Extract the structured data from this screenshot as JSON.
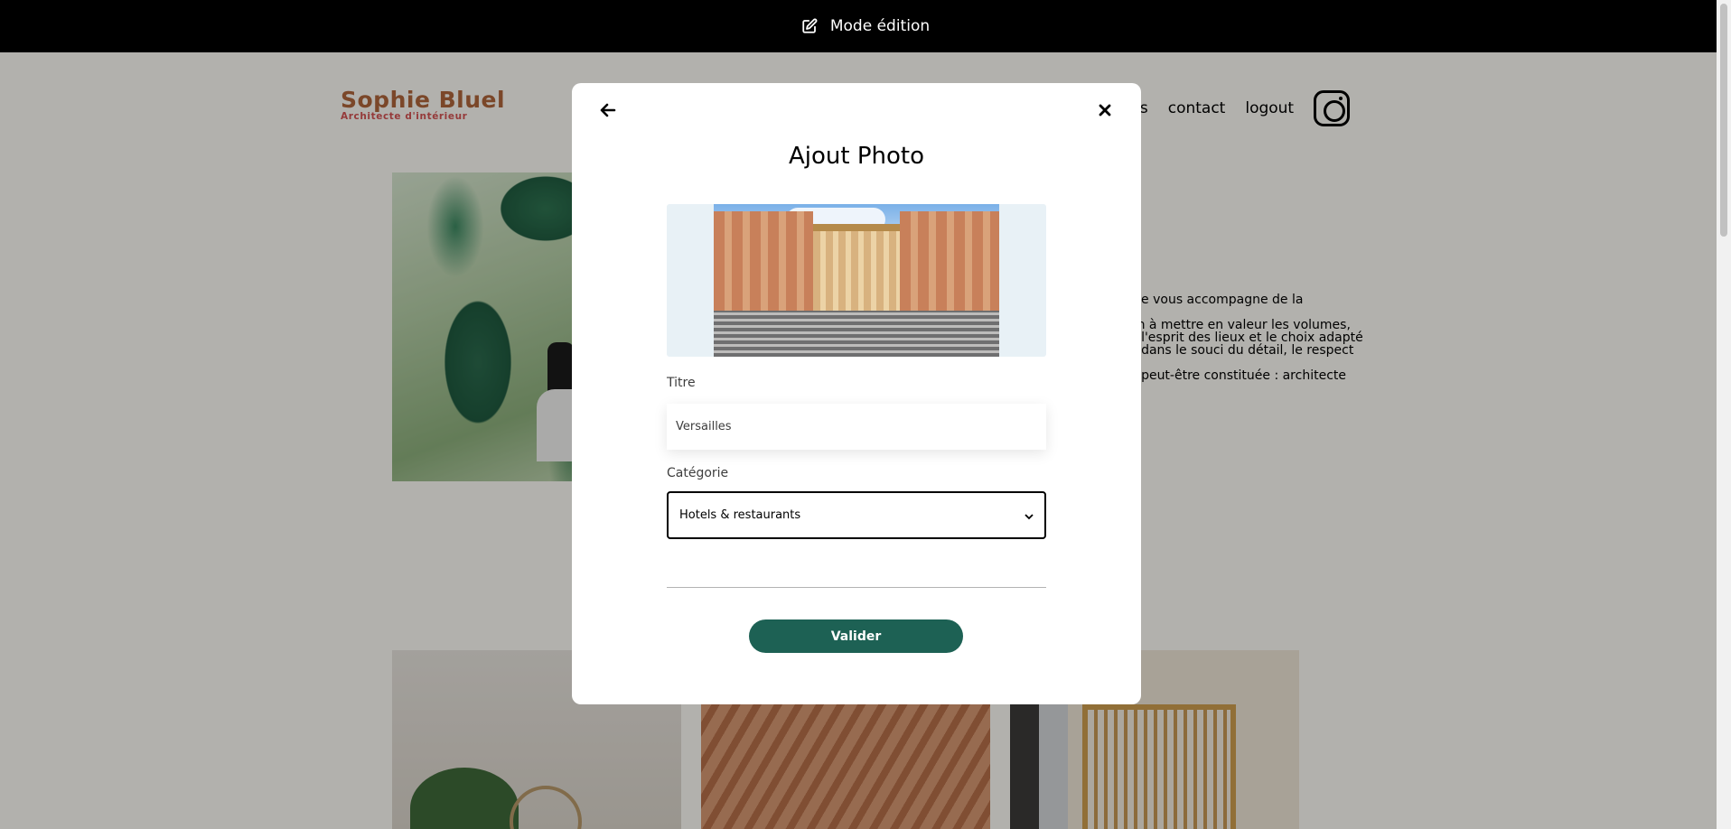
{
  "edit_bar": {
    "label": "Mode édition",
    "icon": "edit-icon"
  },
  "header": {
    "logo_title": "Sophie Bluel",
    "logo_subtitle": "Architecte d'intérieur",
    "nav": {
      "projects_partial": "jets",
      "contact": "contact",
      "logout": "logout",
      "instagram_icon": "instagram-icon"
    }
  },
  "intro": {
    "lines": [
      ". Je vous accompagne de la",
      "on à mettre en valeur les volumes,\ne l'esprit des lieux et le choix adapté\né dans le souci du détail, le respect",
      "e peut-être constituée : architecte"
    ]
  },
  "modal": {
    "title": "Ajout Photo",
    "back_icon": "arrow-left-icon",
    "close_icon": "close-icon",
    "title_label": "Titre",
    "title_value": "Versailles",
    "category_label": "Catégorie",
    "category_value": "Hotels & restaurants",
    "submit_label": "Valider"
  },
  "colors": {
    "brand": "#b1663c",
    "accent": "#1d6154",
    "edit_bar": "#000000",
    "upload_bg": "#e8f1f6"
  }
}
